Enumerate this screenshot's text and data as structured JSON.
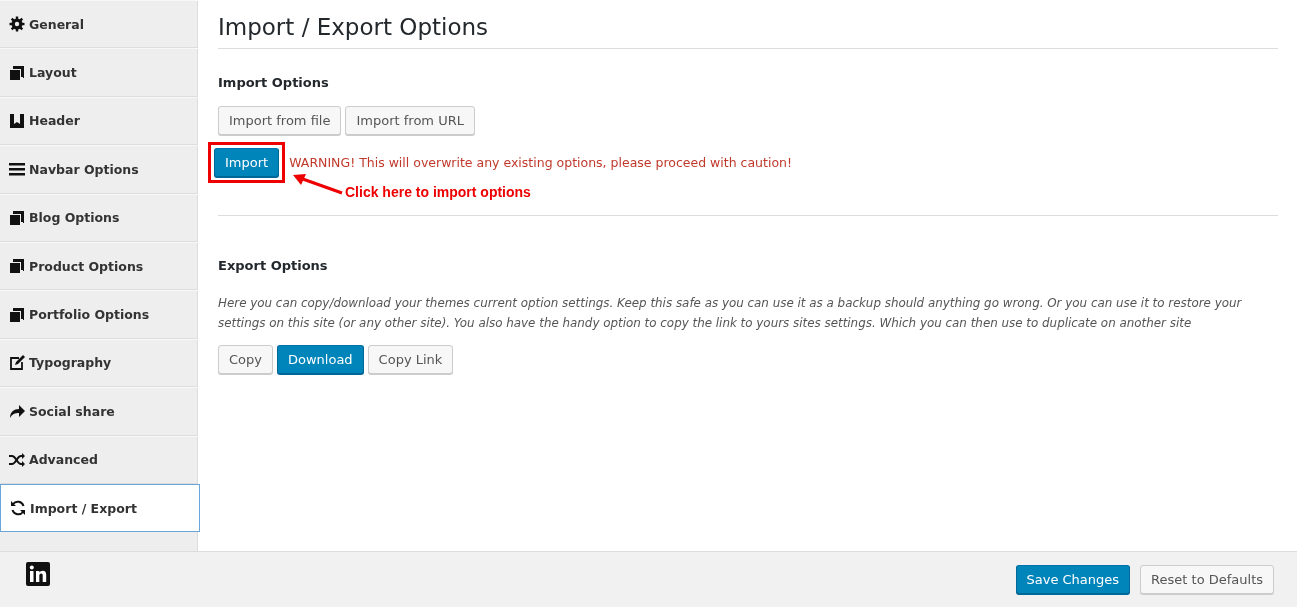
{
  "sidebar": {
    "items": [
      {
        "label": "General",
        "selected": false
      },
      {
        "label": "Layout",
        "selected": false
      },
      {
        "label": "Header",
        "selected": false
      },
      {
        "label": "Navbar Options",
        "selected": false
      },
      {
        "label": "Blog Options",
        "selected": false
      },
      {
        "label": "Product Options",
        "selected": false
      },
      {
        "label": "Portfolio Options",
        "selected": false
      },
      {
        "label": "Typography",
        "selected": false
      },
      {
        "label": "Social share",
        "selected": false
      },
      {
        "label": "Advanced",
        "selected": false
      },
      {
        "label": "Import / Export",
        "selected": true
      }
    ]
  },
  "page_title": "Import / Export Options",
  "import_section": {
    "heading": "Import Options",
    "buttons": [
      {
        "label": "Import from file",
        "kind": "secondary"
      },
      {
        "label": "Import from URL",
        "kind": "secondary"
      }
    ],
    "import_button": {
      "label": "Import",
      "kind": "primary"
    },
    "warning": "WARNING! This will overwrite any existing options, please proceed with caution!",
    "annotation": "Click here to import options"
  },
  "export_section": {
    "heading": "Export Options",
    "description": "Here you can copy/download your themes current option settings. Keep this safe as you can use it as a backup should anything go wrong. Or you can use it to restore your settings on this site (or any other site). You also have the handy option to copy the link to yours sites settings. Which you can then use to duplicate on another site",
    "buttons": [
      {
        "label": "Copy",
        "kind": "secondary"
      },
      {
        "label": "Download",
        "kind": "primary"
      },
      {
        "label": "Copy Link",
        "kind": "secondary"
      }
    ]
  },
  "footer": {
    "buttons": [
      {
        "label": "Save Changes",
        "kind": "primary"
      },
      {
        "label": "Reset to Defaults",
        "kind": "secondary"
      }
    ]
  }
}
